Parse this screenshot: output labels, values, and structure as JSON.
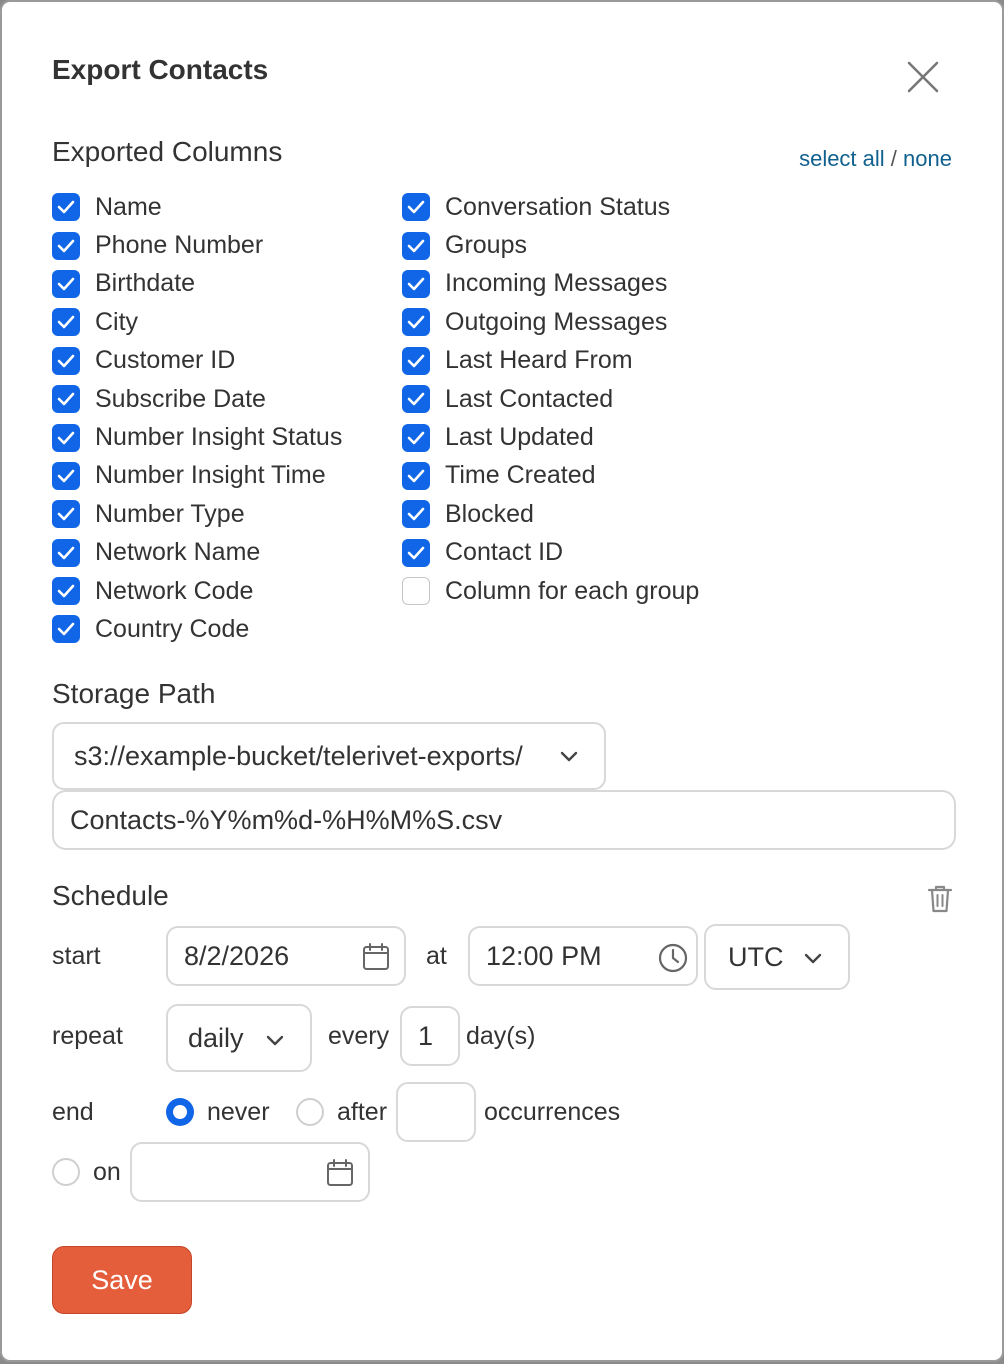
{
  "dialog": {
    "title": "Export Contacts",
    "close_icon": "close-icon"
  },
  "columns": {
    "heading": "Exported Columns",
    "select_all": "select all",
    "separator": "/",
    "select_none": "none",
    "left": [
      {
        "label": "Name",
        "checked": true
      },
      {
        "label": "Phone Number",
        "checked": true
      },
      {
        "label": "Birthdate",
        "checked": true
      },
      {
        "label": "City",
        "checked": true
      },
      {
        "label": "Customer ID",
        "checked": true
      },
      {
        "label": "Subscribe Date",
        "checked": true
      },
      {
        "label": "Number Insight Status",
        "checked": true
      },
      {
        "label": "Number Insight Time",
        "checked": true
      },
      {
        "label": "Number Type",
        "checked": true
      },
      {
        "label": "Network Name",
        "checked": true
      },
      {
        "label": "Network Code",
        "checked": true
      },
      {
        "label": "Country Code",
        "checked": true
      }
    ],
    "right": [
      {
        "label": "Conversation Status",
        "checked": true
      },
      {
        "label": "Groups",
        "checked": true
      },
      {
        "label": "Incoming Messages",
        "checked": true
      },
      {
        "label": "Outgoing Messages",
        "checked": true
      },
      {
        "label": "Last Heard From",
        "checked": true
      },
      {
        "label": "Last Contacted",
        "checked": true
      },
      {
        "label": "Last Updated",
        "checked": true
      },
      {
        "label": "Time Created",
        "checked": true
      },
      {
        "label": "Blocked",
        "checked": true
      },
      {
        "label": "Contact ID",
        "checked": true
      },
      {
        "label": "Column for each group",
        "checked": false
      }
    ]
  },
  "storage": {
    "heading": "Storage Path",
    "bucket": "s3://example-bucket/telerivet-exports/",
    "filename": "Contacts-%Y%m%d-%H%M%S.csv"
  },
  "schedule": {
    "heading": "Schedule",
    "start_label": "start",
    "start_date": "8/2/2026",
    "at_label": "at",
    "start_time": "12:00 PM",
    "timezone": "UTC",
    "repeat_label": "repeat",
    "repeat_value": "daily",
    "every_label": "every",
    "every_value": "1",
    "unit_label": "day(s)",
    "end_label": "end",
    "never_label": "never",
    "after_label": "after",
    "occurrences_value": "",
    "occurrences_label": "occurrences",
    "on_label": "on",
    "end_date_value": "",
    "end_selected": "never"
  },
  "actions": {
    "save_label": "Save"
  },
  "colors": {
    "accent": "#1166e8",
    "save": "#e45e3c",
    "link": "#11618f"
  }
}
